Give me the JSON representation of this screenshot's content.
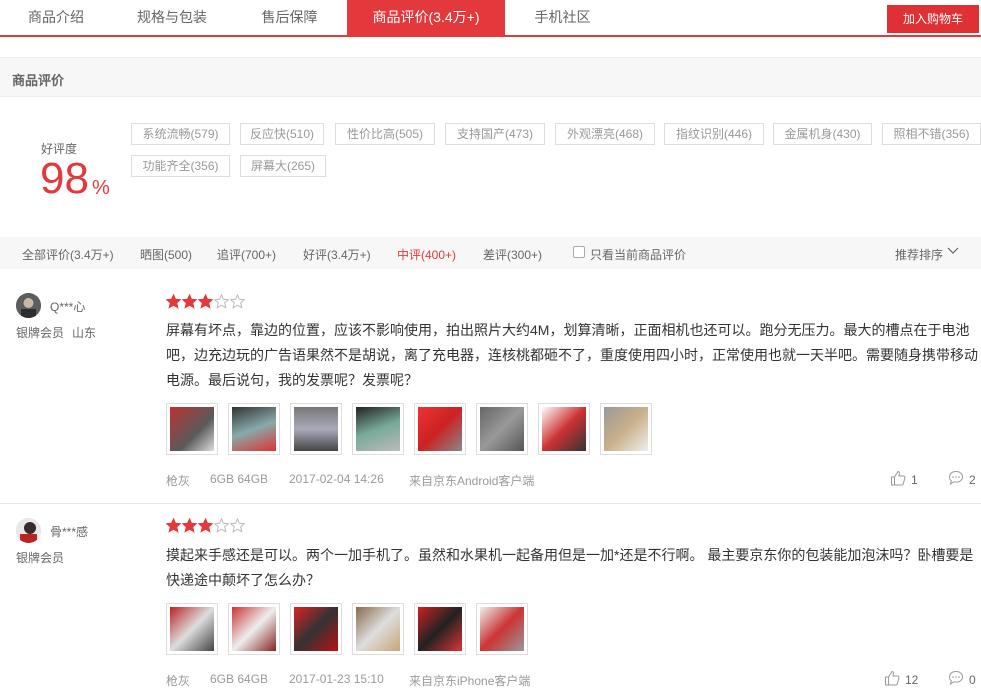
{
  "tabs": [
    {
      "label": "商品介绍"
    },
    {
      "label": "规格与包装"
    },
    {
      "label": "售后保障"
    },
    {
      "label": "商品评价(3.4万+)",
      "active": true
    },
    {
      "label": "手机社区"
    }
  ],
  "cart_button": "加入购物车",
  "section_title": "商品评价",
  "rating": {
    "label": "好评度",
    "value": "98",
    "unit": "%"
  },
  "tags": [
    "系统流畅(579)",
    "反应快(510)",
    "性价比高(505)",
    "支持国产(473)",
    "外观漂亮(468)",
    "指纹识别(446)",
    "金属机身(430)",
    "照相不错(356)",
    "功能齐全(356)",
    "屏幕大(265)"
  ],
  "filters": {
    "items": [
      "全部评价(3.4万+)",
      "晒图(500)",
      "追评(700+)",
      "好评(3.4万+)",
      "中评(400+)",
      "差评(300+)"
    ],
    "active_index": 4,
    "only_current": "只看当前商品评价",
    "sort": "推荐排序"
  },
  "comments": [
    {
      "user": "Q***心",
      "level": "银牌会员",
      "location": "山东",
      "stars": 3,
      "max_stars": 5,
      "text": "屏幕有坏点，靠边的位置，应该不影响使用，拍出照片大约4M，划算清晰，正面相机也还可以。跑分无压力。最大的槽点在于电池吧，边充边玩的广告语果然不是胡说，离了充电器，连核桃都砸不了，重度使用四小时，正常使用也就一天半吧。需要随身携带移动电源。最后说句，我的发票呢？发票呢？",
      "photo_count": 8,
      "color": "枪灰",
      "spec": "6GB 64GB",
      "date": "2017-02-04 14:26",
      "source": "来自京东Android客户端",
      "likes": "1",
      "replies": "2"
    },
    {
      "user": "骨***感",
      "level": "银牌会员",
      "location": "",
      "stars": 3,
      "max_stars": 5,
      "text": "摸起来手感还是可以。两个一加手机了。虽然和水果机一起备用但是一加*还是不行啊。 最主要京东你的包装能加泡沫吗？卧槽要是快递途中颠坏了怎么办？",
      "photo_count": 6,
      "color": "枪灰",
      "spec": "6GB 64GB",
      "date": "2017-01-23 15:10",
      "source": "来自京东iPhone客户端",
      "likes": "12",
      "replies": "0"
    }
  ],
  "colors": {
    "accent": "#e4393c",
    "star_filled": "#e4393c",
    "star_empty": "#cccccc"
  }
}
